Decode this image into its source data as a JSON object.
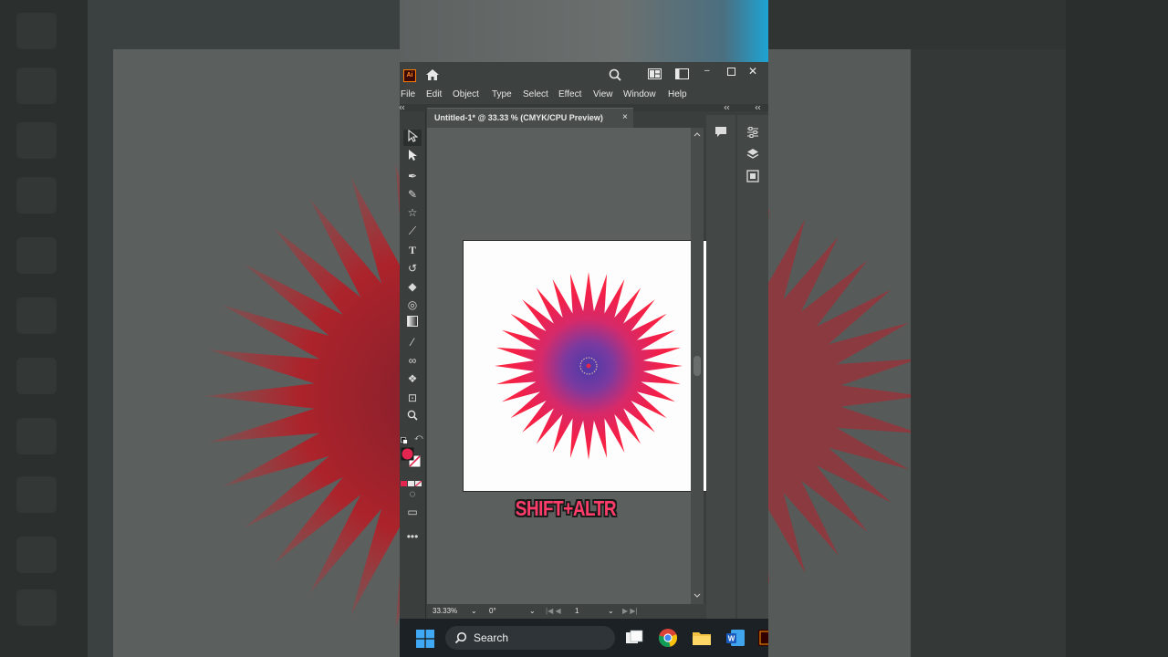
{
  "window": {
    "app_logo": "Ai",
    "icons": [
      "home-icon",
      "search-icon",
      "arrange-documents-icon",
      "workspace-icon",
      "minimize-icon",
      "maximize-icon",
      "close-icon"
    ]
  },
  "menu": {
    "items": [
      "File",
      "Edit",
      "Object",
      "Type",
      "Select",
      "Effect",
      "View",
      "Window",
      "Help"
    ]
  },
  "document": {
    "tab_label": "Untitled-1* @ 33.33 % (CMYK/CPU Preview)",
    "close_glyph": "×"
  },
  "overlay": {
    "shortcut_text": "SHIFT+ALTR"
  },
  "artwork": {
    "gradient_colors": [
      "#4b3aa8",
      "#7a3aa0",
      "#d62a6a",
      "#f21f4a",
      "#ff2b3c"
    ],
    "star_points": 32
  },
  "status": {
    "zoom": "33.33%",
    "rotation": "0°",
    "artboard_number": "1"
  },
  "taskbar": {
    "search_label": "Search",
    "apps": [
      "windows-start-icon",
      "file-explorer-icon",
      "chrome-icon",
      "folder-icon",
      "word-icon",
      "illustrator-icon"
    ]
  },
  "colors": {
    "accent_fill": "#e2264f",
    "ui_dark": "#3a3f3e",
    "canvas": "#5b605f"
  }
}
